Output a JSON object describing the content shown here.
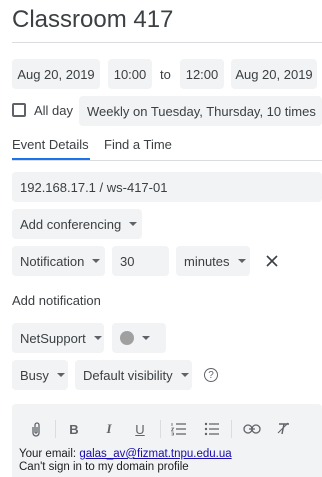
{
  "event": {
    "title": "Classroom 417",
    "start_date": "Aug 20, 2019",
    "start_time": "10:00",
    "to_label": "to",
    "end_time": "12:00",
    "end_date": "Aug 20, 2019",
    "all_day_label": "All day",
    "recurrence": "Weekly on Tuesday, Thursday, 10 times"
  },
  "tabs": {
    "event_details": "Event Details",
    "find_time": "Find a Time"
  },
  "details": {
    "location": "192.168.17.1 / ws-417-01",
    "conferencing": "Add conferencing",
    "notification_type": "Notification",
    "notification_value": "30",
    "notification_unit": "minutes",
    "add_notification": "Add notification",
    "calendar": "NetSupport",
    "availability": "Busy",
    "visibility": "Default visibility",
    "help_symbol": "?"
  },
  "editor": {
    "tools": [
      "attach-icon",
      "bold-icon",
      "italic-icon",
      "underline-icon",
      "numbered-list-icon",
      "bulleted-list-icon",
      "link-icon",
      "clear-format-icon"
    ],
    "description_prefix": "Your email: ",
    "description_email": "galas_av@fizmat.tnpu.edu.ua",
    "description_line2": "Can't sign in to my domain profile"
  },
  "colors": {
    "accent": "#1a73e8",
    "chip_bg": "#f1f3f4",
    "event_color": "#a0a0a0"
  }
}
